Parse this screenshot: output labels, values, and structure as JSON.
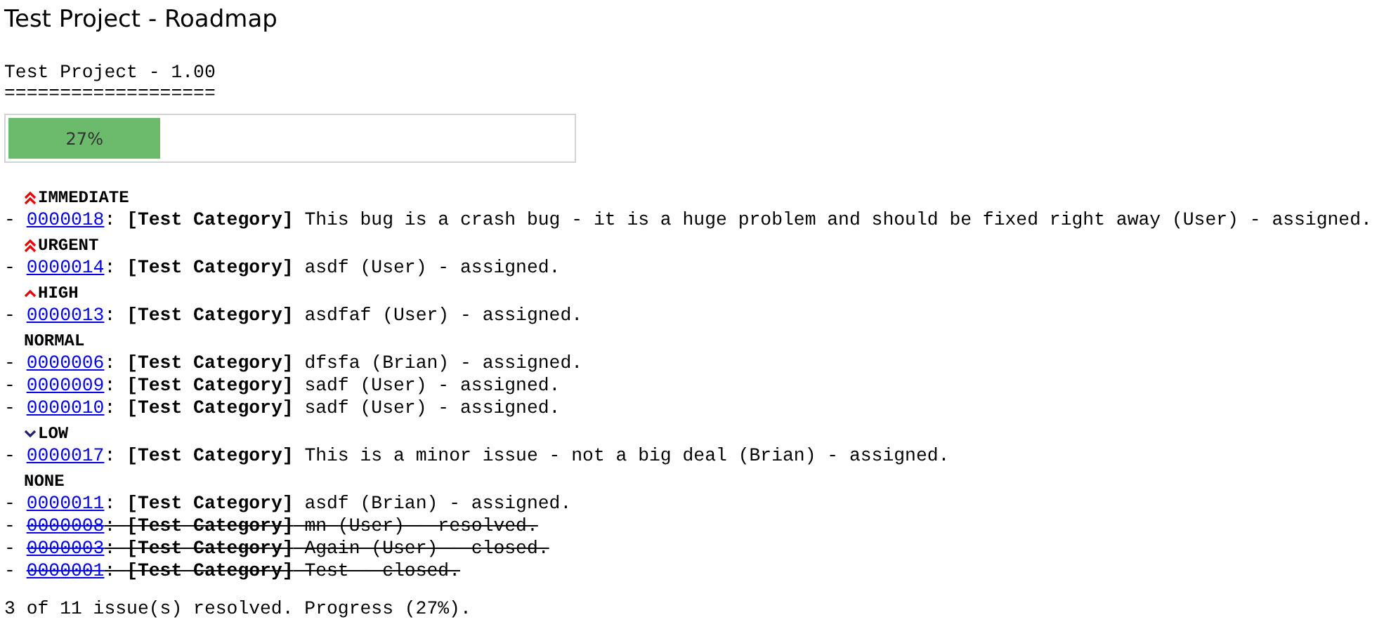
{
  "title": "Test Project - Roadmap",
  "version": {
    "heading": "Test Project - 1.00",
    "underline": "==================="
  },
  "progress": {
    "level": 0.27,
    "label": "27%"
  },
  "groups": [
    {
      "priority": "IMMEDIATE",
      "kind": "double-up",
      "issues": [
        {
          "bullet": "- ",
          "id": "0000018",
          "rest": ": **[Test Category]** This bug is a crash bug - it is a huge problem and should be fixed right away (User) - assigned.",
          "resolved": false
        }
      ]
    },
    {
      "priority": "URGENT",
      "kind": "double-up",
      "issues": [
        {
          "bullet": "- ",
          "id": "0000014",
          "rest": ": **[Test Category]** asdf (User) - assigned.",
          "resolved": false
        }
      ]
    },
    {
      "priority": "HIGH",
      "kind": "up",
      "issues": [
        {
          "bullet": "- ",
          "id": "0000013",
          "rest": ": **[Test Category]** asdfaf (User) - assigned.",
          "resolved": false
        }
      ]
    },
    {
      "priority": "NORMAL",
      "kind": "plain",
      "issues": [
        {
          "bullet": "- ",
          "id": "0000006",
          "rest": ": **[Test Category]** dfsfa (Brian) - assigned.",
          "resolved": false
        },
        {
          "bullet": "- ",
          "id": "0000009",
          "rest": ": **[Test Category]** sadf (User) - assigned.",
          "resolved": false
        },
        {
          "bullet": "- ",
          "id": "0000010",
          "rest": ": **[Test Category]** sadf (User) - assigned.",
          "resolved": false
        }
      ]
    },
    {
      "priority": "LOW",
      "kind": "down",
      "issues": [
        {
          "bullet": "- ",
          "id": "0000017",
          "rest": ": **[Test Category]** This is a minor issue - not a big deal (Brian) - assigned.",
          "resolved": false
        }
      ]
    },
    {
      "priority": "NONE",
      "kind": "plain",
      "issues": [
        {
          "bullet": "- ",
          "id": "0000011",
          "rest": ": **[Test Category]** asdf (Brian) - assigned.",
          "resolved": false
        },
        {
          "bullet": "- ",
          "id": "0000008",
          "rest": ": **[Test Category]** mn (User) - resolved.",
          "resolved": true
        },
        {
          "bullet": "- ",
          "id": "0000003",
          "rest": ": **[Test Category]** Again (User) - closed.",
          "resolved": true
        },
        {
          "bullet": "- ",
          "id": "0000001",
          "rest": ": **[Test Category]** Test - closed.",
          "resolved": true
        }
      ]
    }
  ],
  "footer": "3 of 11 issue(s) resolved. Progress (27%)."
}
